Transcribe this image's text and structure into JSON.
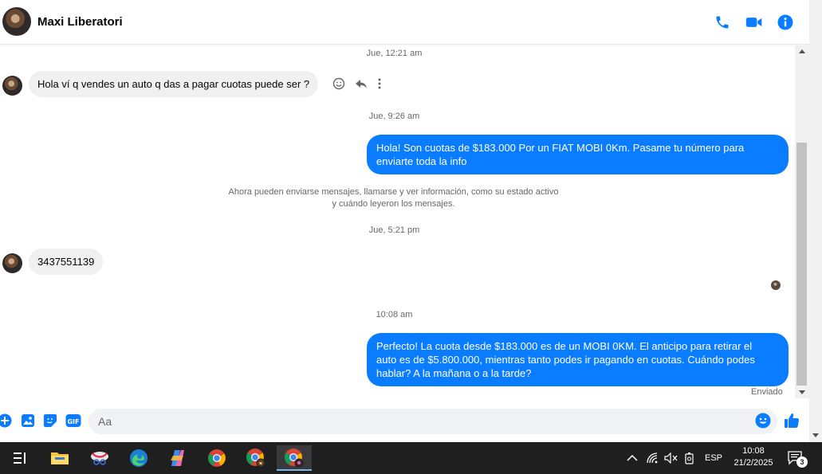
{
  "header": {
    "contact_name": "Maxi Liberatori"
  },
  "chat": {
    "timestamps": [
      "Jue, 12:21 am",
      "Jue, 9:26 am",
      "Jue, 5:21 pm",
      "10:08 am"
    ],
    "messages": [
      {
        "direction": "in",
        "text": "Hola ví q vendes un  auto q das a pagar cuotas puede ser ?"
      },
      {
        "direction": "out",
        "lines": [
          "Hola! Son cuotas de $183.000 Por un FIAT MOBI 0Km. Pasame tu número para",
          "enviarte toda la info"
        ]
      },
      {
        "direction": "in",
        "text": "3437551139"
      },
      {
        "direction": "out",
        "lines": [
          "Perfecto! La cuota desde $183.000 es de un MOBI 0KM. El anticipo para retirar el",
          "auto es de $5.800.000, mientras tanto podes ir pagando en cuotas. Cuándo podes",
          "hablar? A la mañana o a la tarde?"
        ]
      }
    ],
    "system_message": [
      "Ahora pueden enviarse mensajes, llamarse y ver información, como su estado activo",
      "y cuándo leyeron los mensajes."
    ],
    "sent_status": "Enviado"
  },
  "composer": {
    "placeholder": "Aa"
  },
  "taskbar": {
    "language": "ESP",
    "time": "10:08",
    "date": "21/2/2025",
    "notification_count": "3"
  },
  "colors": {
    "accent": "#0a7cff",
    "incoming_bubble": "#f0f0f0",
    "taskbar": "#1f1f20"
  }
}
